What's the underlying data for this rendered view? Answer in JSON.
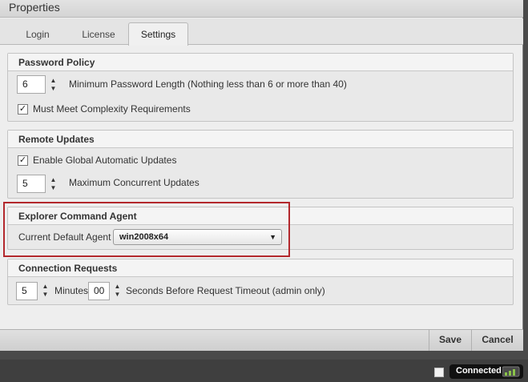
{
  "window": {
    "title": "Properties"
  },
  "tabs": [
    {
      "label": "Login"
    },
    {
      "label": "License"
    },
    {
      "label": "Settings",
      "active": true
    }
  ],
  "password_policy": {
    "header": "Password Policy",
    "min_length_value": "6",
    "min_length_label": "Minimum Password Length (Nothing less than 6 or more than 40)",
    "complexity_label": "Must Meet Complexity Requirements",
    "complexity_checked": true
  },
  "remote_updates": {
    "header": "Remote Updates",
    "auto_updates_label": "Enable Global Automatic Updates",
    "auto_updates_checked": true,
    "max_concurrent_value": "5",
    "max_concurrent_label": "Maximum Concurrent Updates"
  },
  "explorer_agent": {
    "header": "Explorer Command Agent",
    "default_agent_label": "Current Default Agent",
    "default_agent_value": "win2008x64"
  },
  "connection_requests": {
    "header": "Connection Requests",
    "minutes_value": "5",
    "minutes_label": "Minutes",
    "seconds_value": "00",
    "seconds_label": "Seconds Before Request Timeout (admin only)"
  },
  "footer": {
    "save_label": "Save",
    "cancel_label": "Cancel"
  },
  "status": {
    "connection_label": "Connected",
    "highlight_color": "#b3282d"
  },
  "icons": {
    "checkmark": "✓",
    "spinner_arrows": "▲▼",
    "dropdown_arrow": "▼"
  }
}
